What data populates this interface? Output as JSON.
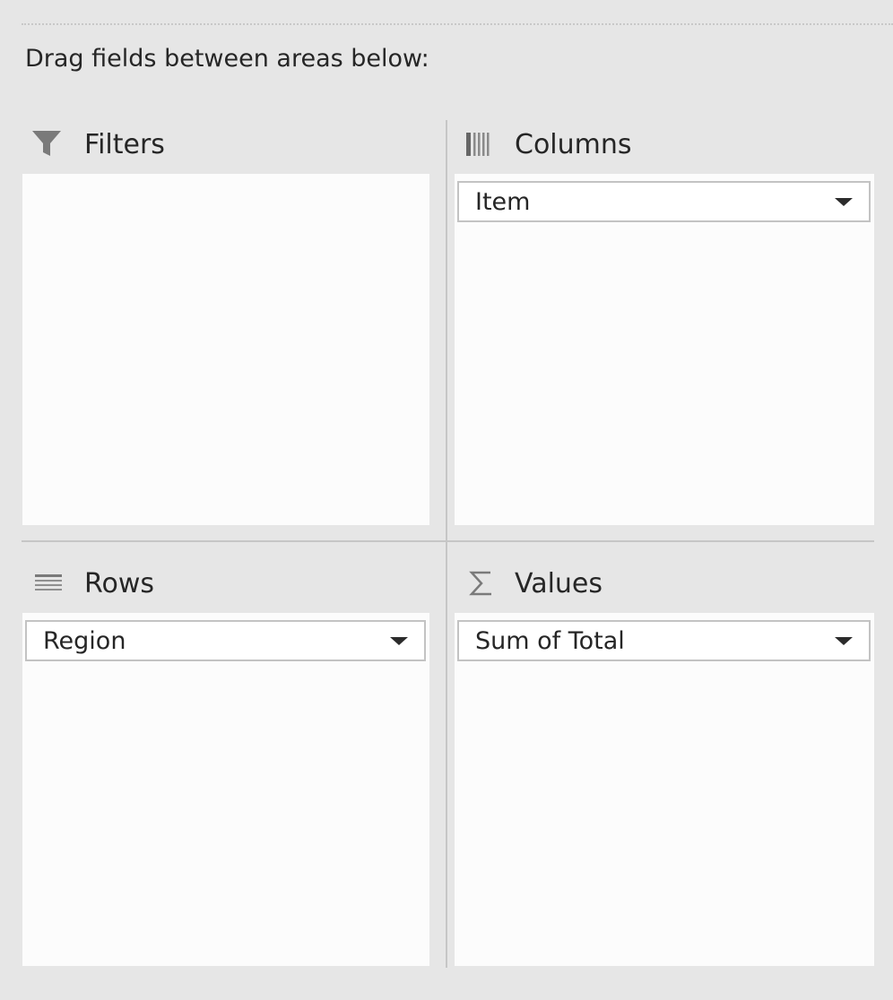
{
  "instructions": "Drag fields between areas below:",
  "areas": {
    "filters": {
      "label": "Filters",
      "icon": "filter-icon",
      "fields": []
    },
    "columns": {
      "label": "Columns",
      "icon": "columns-icon",
      "fields": [
        {
          "label": "Item"
        }
      ]
    },
    "rows": {
      "label": "Rows",
      "icon": "rows-icon",
      "fields": [
        {
          "label": "Region"
        }
      ]
    },
    "values": {
      "label": "Values",
      "icon": "sigma-icon",
      "fields": [
        {
          "label": "Sum of Total"
        }
      ]
    }
  },
  "colors": {
    "panel_background": "#e6e6e6",
    "area_background": "#fcfcfc",
    "pill_border": "#c3c3c3",
    "icon_gray": "#7a7a7a",
    "text": "#262626"
  }
}
